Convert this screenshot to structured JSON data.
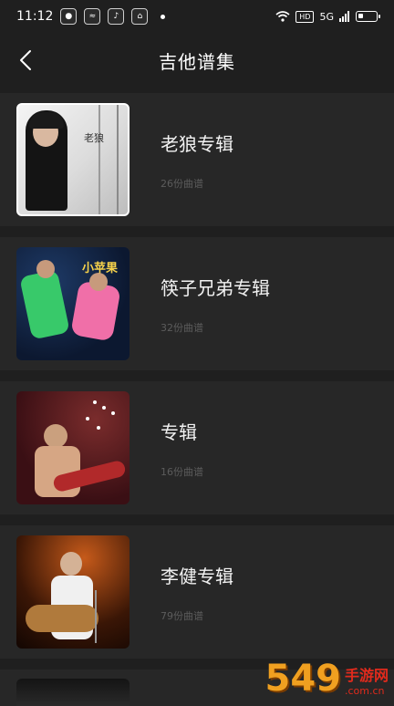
{
  "status": {
    "time": "11:12",
    "app_icons": [
      "app-1",
      "app-2",
      "tiktok",
      "app-4"
    ],
    "signal": "5G",
    "hd": "HD",
    "battery_level": 0.3
  },
  "header": {
    "title": "吉他谱集"
  },
  "albums": [
    {
      "title": "老狼专辑",
      "count": "26份曲谱",
      "cover_caption": "老狼"
    },
    {
      "title": "筷子兄弟专辑",
      "count": "32份曲谱",
      "cover_caption": "小苹果"
    },
    {
      "title": "专辑",
      "count": "16份曲谱"
    },
    {
      "title": "李健专辑",
      "count": "79份曲谱"
    }
  ],
  "watermark": {
    "number": "549",
    "site": "手游网",
    "url": ".com.cn"
  }
}
